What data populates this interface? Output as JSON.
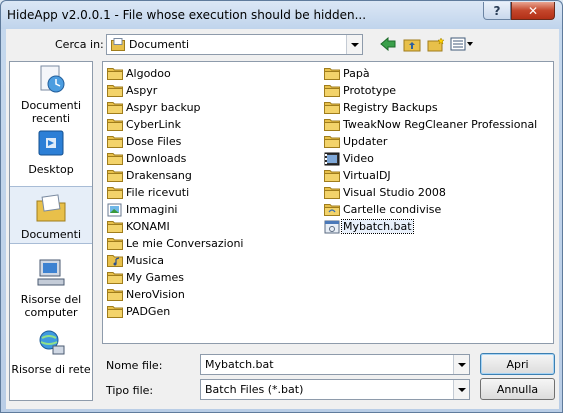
{
  "window": {
    "title": "HideApp v2.0.0.1 - File whose execution should be hidden...",
    "help_label": "?",
    "close_label": "✕"
  },
  "lookin": {
    "label": "Cerca in:",
    "value": "Documenti"
  },
  "places": [
    {
      "label": "Documenti recenti",
      "icon": "recent-documents-icon"
    },
    {
      "label": "Desktop",
      "icon": "desktop-icon"
    },
    {
      "label": "Documenti",
      "icon": "documents-icon",
      "selected": true
    },
    {
      "label": "Risorse del computer",
      "icon": "computer-icon"
    },
    {
      "label": "Risorse di rete",
      "icon": "network-icon"
    }
  ],
  "files_col1": [
    "Algodoo",
    "Aspyr",
    "Aspyr backup",
    "CyberLink",
    "Dose Files",
    "Downloads",
    "Drakensang",
    "File ricevuti",
    "Immagini",
    "KONAMI",
    "Le mie Conversazioni",
    "Musica",
    "My Games",
    "NeroVision",
    "PADGen"
  ],
  "files_col2": [
    "Papà",
    "Prototype",
    "Registry Backups",
    "TweakNow RegCleaner Professional",
    "Updater",
    "Video",
    "VirtualDJ",
    "Visual Studio 2008",
    "Cartelle condivise",
    "Mybatch.bat"
  ],
  "bottom": {
    "filename_label": "Nome file:",
    "filename_value": "Mybatch.bat",
    "filetype_label": "Tipo file:",
    "filetype_value": "Batch Files (*.bat)",
    "open_label": "Apri",
    "cancel_label": "Annulla"
  },
  "colors": {
    "folder": "#e8c04a",
    "selection": "#e8f0fb",
    "close": "#c4462b"
  }
}
